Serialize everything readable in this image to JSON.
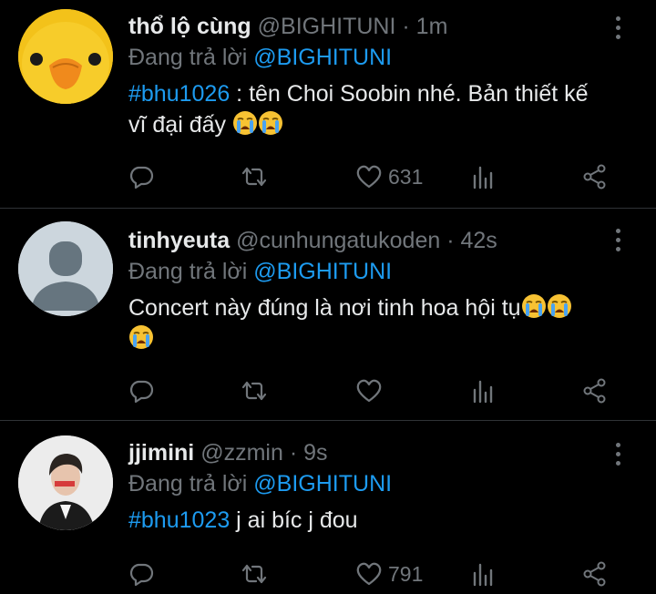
{
  "tweets": [
    {
      "name": "thổ lộ cùng",
      "handle": "@BIGHITUNI",
      "dot": "·",
      "time": "1m",
      "reply_prefix": "Đang trả lời",
      "reply_to": "@BIGHITUNI",
      "hashtag": "#bhu1026",
      "text": " : tên Choi Soobin nhé. Bản thiết kế vĩ đại đấy",
      "likes": "631",
      "avatar": "duck-avatar"
    },
    {
      "name": "tinhyeuta",
      "handle": "@cunhungatukoden",
      "dot": "·",
      "time": "42s",
      "reply_prefix": "Đang trả lời",
      "reply_to": "@BIGHITUNI",
      "text": "Concert này đúng là nơi tinh hoa hội tụ",
      "likes": "",
      "avatar": "default-avatar"
    },
    {
      "name": "jjimini",
      "handle": "@zzmin",
      "dot": "·",
      "time": "9s",
      "reply_prefix": "Đang trả lời",
      "reply_to": "@BIGHITUNI",
      "hashtag": "#bhu1023",
      "text": " j ai bíc j đou",
      "likes": "791",
      "avatar": "photo-avatar"
    }
  ],
  "colors": {
    "background": "#000000",
    "link": "#1d9bf0",
    "muted": "#71767b",
    "text": "#e7e9ea"
  },
  "icons": [
    "reply-icon",
    "retweet-icon",
    "like-icon",
    "views-icon",
    "share-icon",
    "more-icon",
    "crying-emoji"
  ]
}
